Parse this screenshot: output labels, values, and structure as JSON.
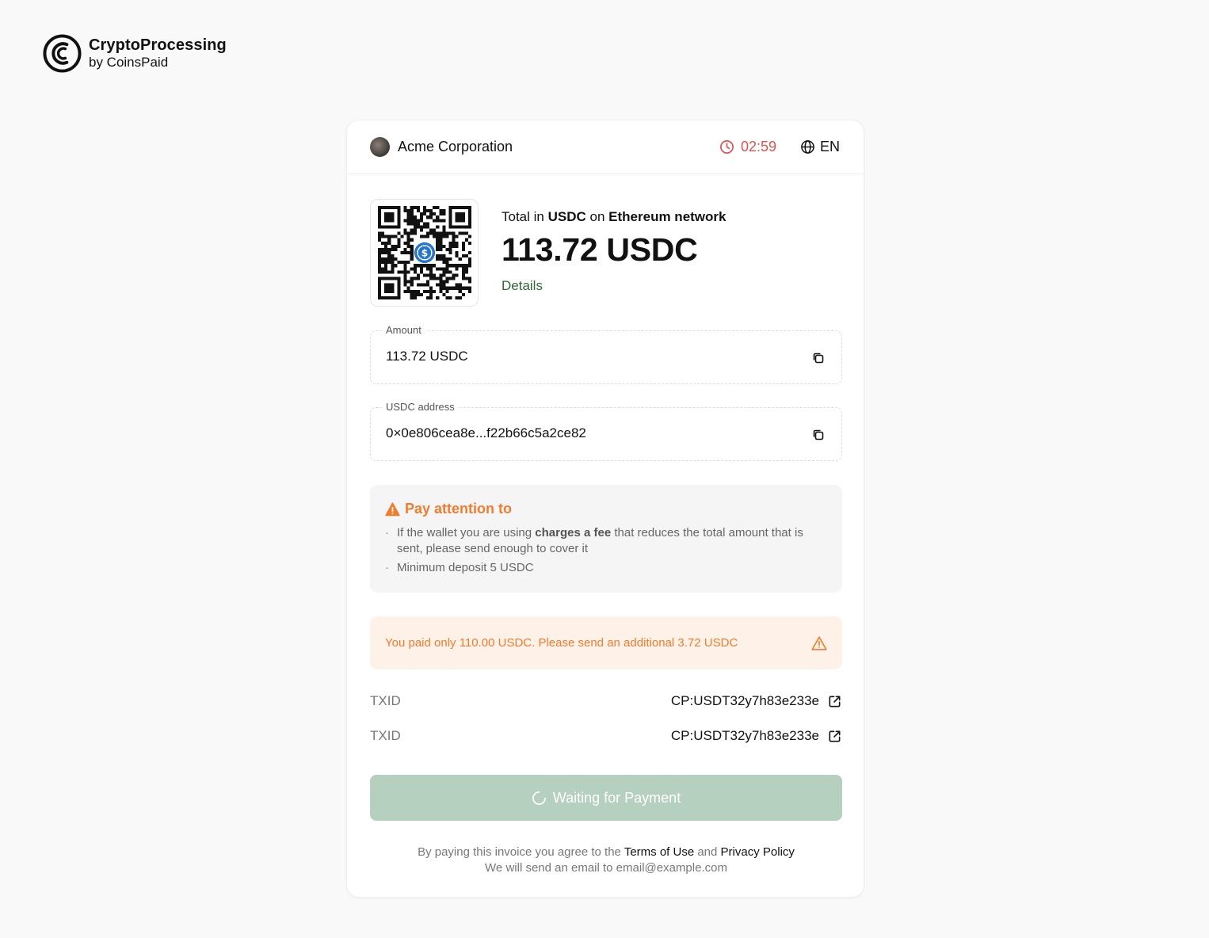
{
  "brand": {
    "name": "CryptoProcessing",
    "sub": "by CoinsPaid"
  },
  "header": {
    "merchant": "Acme Corporation",
    "timer": "02:59",
    "language": "EN"
  },
  "summary": {
    "total_prefix": "Total in",
    "currency": "USDC",
    "on": "on",
    "network": "Ethereum network",
    "amount": "113.72 USDC",
    "details_link": "Details"
  },
  "amount_field": {
    "label": "Amount",
    "value": "113.72 USDC"
  },
  "address_field": {
    "label": "USDC address",
    "value": "0×0e806cea8e...f22b66c5a2ce82"
  },
  "attention": {
    "title": "Pay attention to",
    "item1_pre": "If the wallet you are using",
    "item1_bold": "charges a fee",
    "item1_post": "that reduces the total amount that is sent, please send enough to cover it",
    "item2": "Minimum deposit 5 USDC"
  },
  "alert": {
    "text": "You paid only 110.00 USDC. Please send an additional 3.72 USDC"
  },
  "transactions": [
    {
      "label": "TXID",
      "value": "CP:USDT32y7h83e233e"
    },
    {
      "label": "TXID",
      "value": "CP:USDT32y7h83e233e"
    }
  ],
  "pay_button": {
    "label": "Waiting for Payment"
  },
  "footer": {
    "line1_pre": "By paying this invoice you agree to the",
    "terms": "Terms of Use",
    "and": "and",
    "privacy": "Privacy Policy",
    "line2": "We will send an email to email@example.com"
  },
  "colors": {
    "accent_green": "#2d6a38",
    "button_disabled": "#b6d0bf",
    "warning_orange": "#ef7d2f",
    "timer_red": "#e05252",
    "usdc_blue": "#2775ca"
  },
  "icons": [
    "coinspaid-logo-icon",
    "clock-icon",
    "globe-icon",
    "qr-code",
    "usdc-coin-icon",
    "copy-icon",
    "warning-triangle-icon",
    "external-link-icon",
    "spinner-icon"
  ]
}
